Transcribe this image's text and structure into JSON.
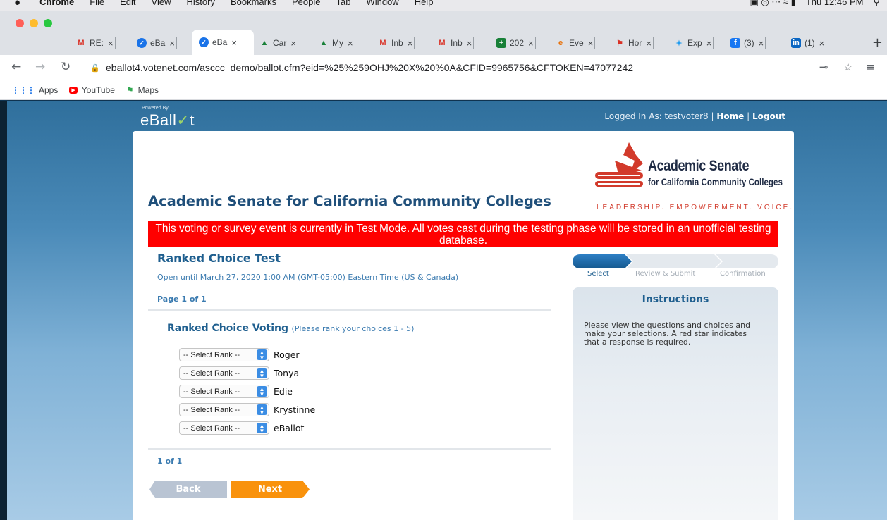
{
  "os_menubar": {
    "apple": "",
    "app": "Chrome",
    "items": [
      "File",
      "Edit",
      "View",
      "History",
      "Bookmarks",
      "People",
      "Tab",
      "Window",
      "Help"
    ],
    "clock": "Thu 12:46 PM"
  },
  "tabs": [
    {
      "label": "RE:",
      "icon": "gmail-icon"
    },
    {
      "label": "eBa",
      "icon": "eballot-icon"
    },
    {
      "label": "eBa",
      "icon": "eballot-icon",
      "active": true
    },
    {
      "label": "Car",
      "icon": "google-drive-icon"
    },
    {
      "label": "My",
      "icon": "google-drive-icon"
    },
    {
      "label": "Inb",
      "icon": "gmail-icon"
    },
    {
      "label": "Inb",
      "icon": "gmail-icon"
    },
    {
      "label": "202",
      "icon": "google-sheets-icon"
    },
    {
      "label": "Eve",
      "icon": "edge-icon"
    },
    {
      "label": "Hor",
      "icon": "honey-icon"
    },
    {
      "label": "Exp",
      "icon": "twitter-icon"
    },
    {
      "label": "(3)",
      "icon": "facebook-icon"
    },
    {
      "label": "(1)",
      "icon": "linkedin-icon"
    }
  ],
  "address_bar": {
    "url": "eballot4.votenet.com/asccc_demo/ballot.cfm?eid=%25%259OHJ%20X%20%0A&CFID=9965756&CFTOKEN=47077242"
  },
  "bookmarks": [
    {
      "label": "Apps",
      "icon": "apps-grid-icon"
    },
    {
      "label": "YouTube",
      "icon": "youtube-icon"
    },
    {
      "label": "Maps",
      "icon": "maps-icon"
    }
  ],
  "site": {
    "powered_by": "Powered By",
    "logo": "eBall",
    "logo_check": "✓",
    "logo_end": "t",
    "logged_in_prefix": "Logged In As: testvoter8 | ",
    "home": "Home",
    "sep": " | ",
    "logout": "Logout"
  },
  "org": {
    "title": "Academic Senate for California Community Colleges",
    "logo_line1": "Academic Senate",
    "logo_line2": "for California Community Colleges",
    "logo_tagline": "LEADERSHIP. EMPOWERMENT. VOICE."
  },
  "banner": {
    "text": "This voting or survey event is currently in Test Mode. All votes cast during the testing phase will be stored in an unofficial testing database.",
    "color": "#ff0000"
  },
  "ballot": {
    "title": "Ranked Choice Test",
    "open_until": "Open until March 27, 2020 1:00 AM (GMT-05:00) Eastern Time (US & Canada)",
    "page_label": "Page 1 of 1",
    "question_title": "Ranked Choice Voting",
    "question_hint": "(Please rank your choices 1 - 5)",
    "select_placeholder": "-- Select Rank --",
    "choices": [
      "Roger",
      "Tonya",
      "Edie",
      "Krystinne",
      "eBallot"
    ],
    "page_count": "1 of 1",
    "back_label": "Back",
    "next_label": "Next"
  },
  "steps": {
    "items": [
      "Select",
      "Review & Submit",
      "Confirmation"
    ],
    "current": 0
  },
  "instructions": {
    "title": "Instructions",
    "body": "Please view the questions and choices and make your selections. A red star indicates that a response is required."
  },
  "colors": {
    "accent_blue": "#1f5f8f",
    "next_orange": "#f9920c",
    "back_gray": "#b9c4d3"
  }
}
